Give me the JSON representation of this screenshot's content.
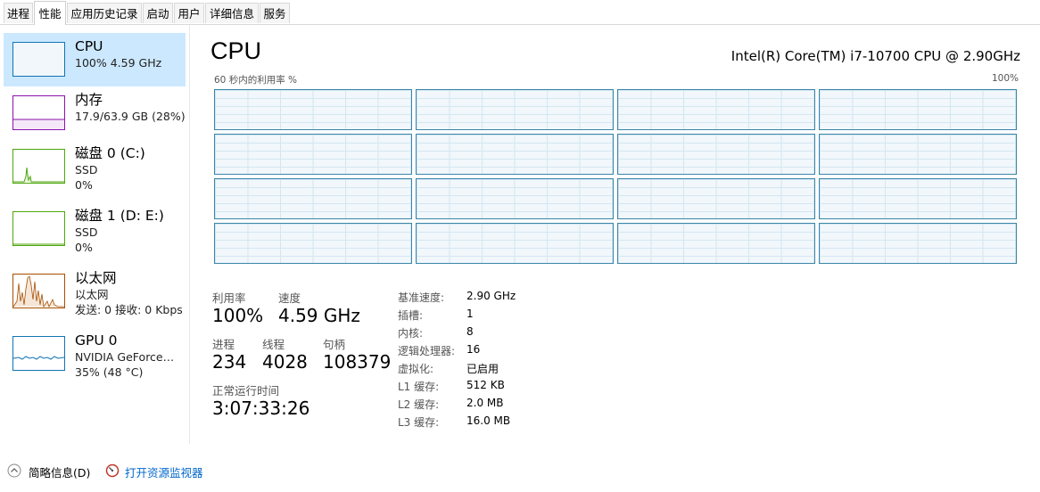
{
  "tabs": [
    "进程",
    "性能",
    "应用历史记录",
    "启动",
    "用户",
    "详细信息",
    "服务"
  ],
  "sidebar": {
    "items": [
      {
        "title": "CPU",
        "sub1": "100% 4.59 GHz",
        "sub2": ""
      },
      {
        "title": "内存",
        "sub1": "17.9/63.9 GB (28%)",
        "sub2": ""
      },
      {
        "title": "磁盘 0 (C:)",
        "sub1": "SSD",
        "sub2": "0%"
      },
      {
        "title": "磁盘 1 (D: E:)",
        "sub1": "SSD",
        "sub2": "0%"
      },
      {
        "title": "以太网",
        "sub1": "以太网",
        "sub2": "发送: 0 接收: 0 Kbps"
      },
      {
        "title": "GPU 0",
        "sub1": "NVIDIA GeForce…",
        "sub2": "35% (48 °C)"
      }
    ]
  },
  "main": {
    "title": "CPU",
    "model": "Intel(R) Core(TM) i7-10700 CPU @ 2.90GHz",
    "util_label": "60 秒内的利用率 %",
    "util_max": "100%",
    "core_count": 16
  },
  "stats": {
    "util_label": "利用率",
    "util_value": "100%",
    "speed_label": "速度",
    "speed_value": "4.59 GHz",
    "proc_label": "进程",
    "proc_value": "234",
    "thread_label": "线程",
    "thread_value": "4028",
    "handle_label": "句柄",
    "handle_value": "108379",
    "uptime_label": "正常运行时间",
    "uptime_value": "3:07:33:26"
  },
  "details": [
    {
      "label": "基准速度:",
      "value": "2.90 GHz"
    },
    {
      "label": "插槽:",
      "value": "1"
    },
    {
      "label": "内核:",
      "value": "8"
    },
    {
      "label": "逻辑处理器:",
      "value": "16"
    },
    {
      "label": "虚拟化:",
      "value": "已启用"
    },
    {
      "label": "L1 缓存:",
      "value": "512 KB"
    },
    {
      "label": "L2 缓存:",
      "value": "2.0 MB"
    },
    {
      "label": "L3 缓存:",
      "value": "16.0 MB"
    }
  ],
  "footer": {
    "summary_label": "简略信息(D)",
    "monitor_label": "打开资源监视器"
  },
  "colors": {
    "cpu": "#1174b5",
    "memory": "#8b12ae",
    "disk": "#4da60c",
    "ethernet": "#a74f01",
    "gpu": "#1174b5",
    "selected_bg": "#cce8ff"
  },
  "icons": [
    "chevron-up-icon",
    "resource-monitor-icon"
  ]
}
